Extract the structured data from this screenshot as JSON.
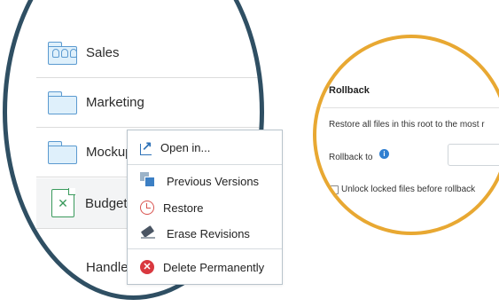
{
  "file_list": {
    "items": [
      {
        "name": "Sales",
        "icon": "shared-folder-icon"
      },
      {
        "name": "Marketing",
        "icon": "folder-icon"
      },
      {
        "name": "Mockup",
        "icon": "folder-icon"
      },
      {
        "name": "Budget",
        "icon": "excel-file-icon"
      },
      {
        "name": "Handle",
        "icon": "file-icon"
      }
    ]
  },
  "context_menu": {
    "open_in": "Open in...",
    "previous_versions": "Previous Versions",
    "restore": "Restore",
    "erase_revisions": "Erase Revisions",
    "delete_permanently": "Delete Permanently"
  },
  "rollback": {
    "title": "Rollback",
    "description": "Restore all files in this root to the most r",
    "rollback_to_label": "Rollback to",
    "info_symbol": "i",
    "rollback_to_value": "",
    "unlock_label": "Unlock locked files before rollback"
  },
  "colors": {
    "left_ring": "#2f4f63",
    "right_ring": "#e8a832",
    "folder_stroke": "#5b9ad0",
    "delete_red": "#d9383f"
  }
}
